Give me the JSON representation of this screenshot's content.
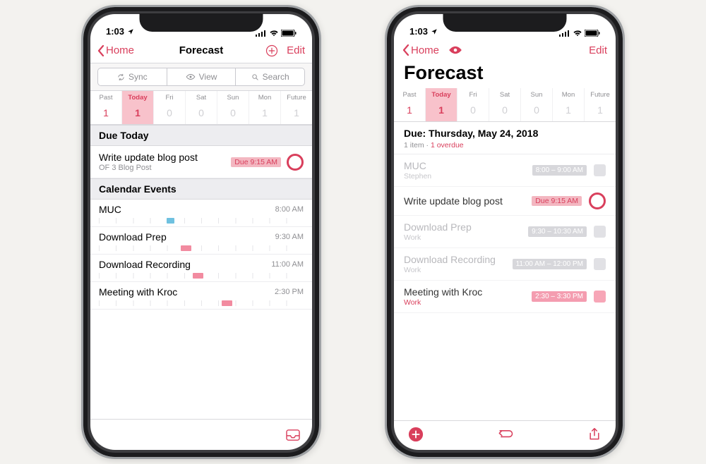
{
  "status": {
    "time": "1:03"
  },
  "phoneA": {
    "back": "Home",
    "title": "Forecast",
    "edit": "Edit",
    "segments": {
      "sync": "Sync",
      "view": "View",
      "search": "Search"
    },
    "days": [
      {
        "label": "Past",
        "value": "1",
        "red": true,
        "sel": false
      },
      {
        "label": "Today",
        "value": "1",
        "red": true,
        "sel": true
      },
      {
        "label": "Fri",
        "value": "0",
        "red": false,
        "sel": false
      },
      {
        "label": "Sat",
        "value": "0",
        "red": false,
        "sel": false
      },
      {
        "label": "Sun",
        "value": "0",
        "red": false,
        "sel": false
      },
      {
        "label": "Mon",
        "value": "1",
        "red": false,
        "sel": false
      },
      {
        "label": "Future",
        "value": "1",
        "red": false,
        "sel": false
      }
    ],
    "dueToday": "Due Today",
    "task": {
      "title": "Write update blog post",
      "project": "OF 3 Blog Post",
      "due": "Due 9:15 AM"
    },
    "calEventsHeader": "Calendar Events",
    "events": [
      {
        "title": "MUC",
        "time": "8:00 AM",
        "color": "#6fc1e0",
        "start": 33,
        "width": 4
      },
      {
        "title": "Download Prep",
        "time": "9:30 AM",
        "color": "#f28ba0",
        "start": 40,
        "width": 5
      },
      {
        "title": "Download Recording",
        "time": "11:00 AM",
        "color": "#f28ba0",
        "start": 46,
        "width": 5
      },
      {
        "title": "Meeting with Kroc",
        "time": "2:30 PM",
        "color": "#f28ba0",
        "start": 60,
        "width": 5
      }
    ]
  },
  "phoneB": {
    "back": "Home",
    "edit": "Edit",
    "title": "Forecast",
    "days": [
      {
        "label": "Past",
        "value": "1",
        "red": true,
        "sel": false
      },
      {
        "label": "Today",
        "value": "1",
        "red": true,
        "sel": true
      },
      {
        "label": "Fri",
        "value": "0",
        "red": false,
        "sel": false
      },
      {
        "label": "Sat",
        "value": "0",
        "red": false,
        "sel": false
      },
      {
        "label": "Sun",
        "value": "0",
        "red": false,
        "sel": false
      },
      {
        "label": "Mon",
        "value": "1",
        "red": false,
        "sel": false
      },
      {
        "label": "Future",
        "value": "1",
        "red": false,
        "sel": false
      }
    ],
    "due": {
      "header": "Due: Thursday, May 24, 2018",
      "count": "1 item",
      "overdue": "1 overdue"
    },
    "rows": [
      {
        "kind": "event",
        "title": "MUC",
        "sub": "Stephen",
        "time": "8:00 – 9:00 AM",
        "dim": true,
        "pink": false
      },
      {
        "kind": "task",
        "title": "Write update blog post",
        "due": "Due 9:15 AM"
      },
      {
        "kind": "event",
        "title": "Download Prep",
        "sub": "Work",
        "time": "9:30 – 10:30 AM",
        "dim": true,
        "pink": false
      },
      {
        "kind": "event",
        "title": "Download Recording",
        "sub": "Work",
        "time": "11:00 AM – 12:00 PM",
        "dim": true,
        "pink": false
      },
      {
        "kind": "event",
        "title": "Meeting with Kroc",
        "sub": "Work",
        "time": "2:30 – 3:30 PM",
        "dim": false,
        "pink": true
      }
    ]
  }
}
